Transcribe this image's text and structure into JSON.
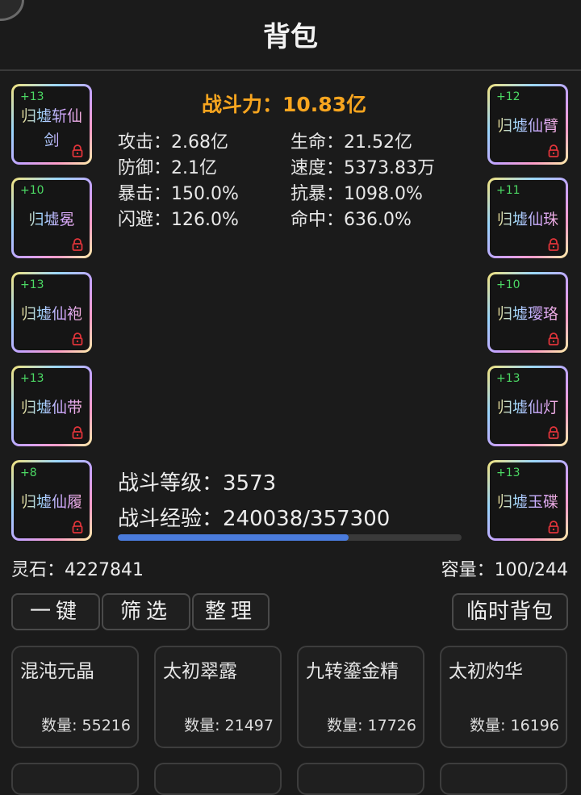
{
  "header": {
    "title": "背包"
  },
  "combat": {
    "power_label": "战斗力：",
    "power_value": "10.83亿",
    "stats": [
      {
        "label": "攻击：",
        "value": "2.68亿"
      },
      {
        "label": "生命：",
        "value": "21.52亿"
      },
      {
        "label": "防御：",
        "value": "2.1亿"
      },
      {
        "label": "速度：",
        "value": "5373.83万"
      },
      {
        "label": "暴击：",
        "value": "150.0%"
      },
      {
        "label": "抗暴：",
        "value": "1098.0%"
      },
      {
        "label": "闪避：",
        "value": "126.0%"
      },
      {
        "label": "命中：",
        "value": "636.0%"
      }
    ],
    "level_label": "战斗等级：",
    "level_value": "3573",
    "exp_label": "战斗经验：",
    "exp_value": "240038/357300",
    "exp_progress": 0.6718
  },
  "equipment": {
    "left": [
      {
        "plus": "+13",
        "name": "归墟斩仙剑"
      },
      {
        "plus": "+10",
        "name": "归墟冕"
      },
      {
        "plus": "+13",
        "name": "归墟仙袍"
      },
      {
        "plus": "+13",
        "name": "归墟仙带"
      },
      {
        "plus": "+8",
        "name": "归墟仙履"
      }
    ],
    "right": [
      {
        "plus": "+12",
        "name": "归墟仙臂"
      },
      {
        "plus": "+11",
        "name": "归墟仙珠"
      },
      {
        "plus": "+10",
        "name": "归墟璎珞"
      },
      {
        "plus": "+13",
        "name": "归墟仙灯"
      },
      {
        "plus": "+13",
        "name": "归墟玉碟"
      }
    ],
    "lock_icon": "lock-icon",
    "lock_color": "#e0343a"
  },
  "info": {
    "stones_label": "灵石：",
    "stones_value": "4227841",
    "capacity_label": "容量：",
    "capacity_value": "100/244"
  },
  "toolbar": {
    "one_key": "一键",
    "filter": "筛选",
    "sort": "整理",
    "temp_bag": "临时背包"
  },
  "items": [
    {
      "name": "混沌元晶",
      "qty_label": "数量:",
      "qty": "55216"
    },
    {
      "name": "太初翠露",
      "qty_label": "数量:",
      "qty": "21497"
    },
    {
      "name": "九转鎏金精",
      "qty_label": "数量:",
      "qty": "17726"
    },
    {
      "name": "太初灼华",
      "qty_label": "数量:",
      "qty": "16196"
    }
  ],
  "colors": {
    "background": "#1b1b1b",
    "power": "#f7a51f",
    "plus": "#4cd964",
    "progress": "#4a7bdc"
  }
}
